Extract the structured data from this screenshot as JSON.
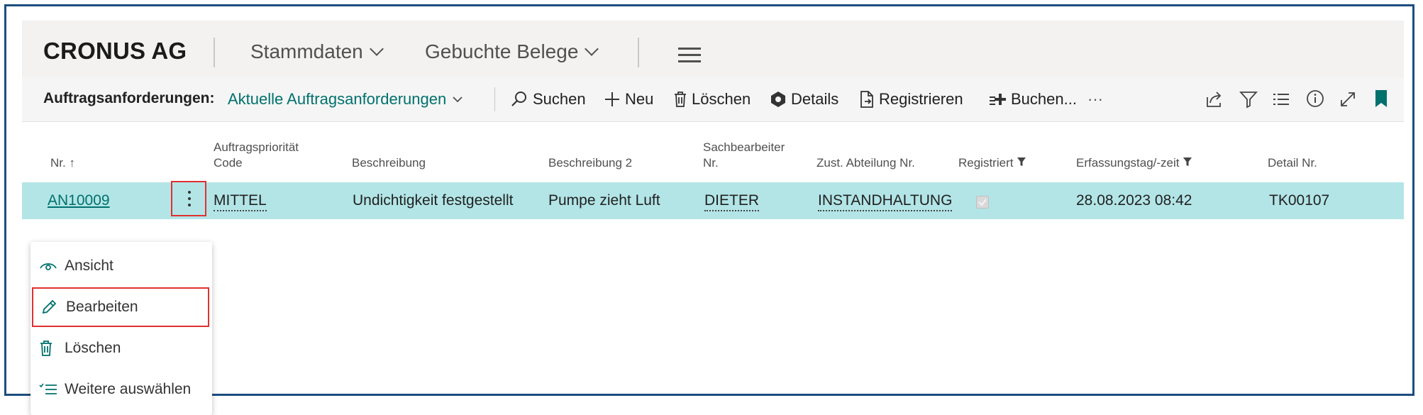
{
  "header": {
    "company": "CRONUS AG",
    "nav": [
      {
        "label": "Stammdaten"
      },
      {
        "label": "Gebuchte Belege"
      }
    ]
  },
  "toolbar": {
    "page_label": "Auftragsanforderungen:",
    "view_label": "Aktuelle Auftragsanforderungen",
    "actions": {
      "search": "Suchen",
      "new": "Neu",
      "delete": "Löschen",
      "details": "Details",
      "register": "Registrieren",
      "post": "Buchen...",
      "more": "···"
    }
  },
  "table": {
    "columns": {
      "nr": "Nr.",
      "priority_line1": "Auftragspriorität",
      "priority_line2": "Code",
      "description": "Beschreibung",
      "description2": "Beschreibung 2",
      "clerk_line1": "Sachbearbeiter",
      "clerk_line2": "Nr.",
      "dept": "Zust. Abteilung Nr.",
      "registered": "Registriert",
      "created": "Erfassungstag/-zeit",
      "detail": "Detail Nr."
    },
    "rows": [
      {
        "nr": "AN10009",
        "priority": "MITTEL",
        "description": "Undichtigkeit festgestellt",
        "description2": "Pumpe zieht Luft",
        "clerk": "DIETER",
        "dept": "INSTANDHALTUNG",
        "registered": true,
        "created": "28.08.2023 08:42",
        "detail": "TK00107"
      }
    ]
  },
  "context_menu": {
    "items": [
      {
        "label": "Ansicht",
        "icon": "eye-icon"
      },
      {
        "label": "Bearbeiten",
        "icon": "pencil-icon"
      },
      {
        "label": "Löschen",
        "icon": "trash-icon"
      },
      {
        "label": "Weitere auswählen",
        "icon": "select-more-icon"
      }
    ]
  },
  "colors": {
    "accent": "#00716d",
    "selected_row": "#b3e5e7",
    "highlight_border": "#e03030",
    "frame_border": "#1c4e80"
  }
}
